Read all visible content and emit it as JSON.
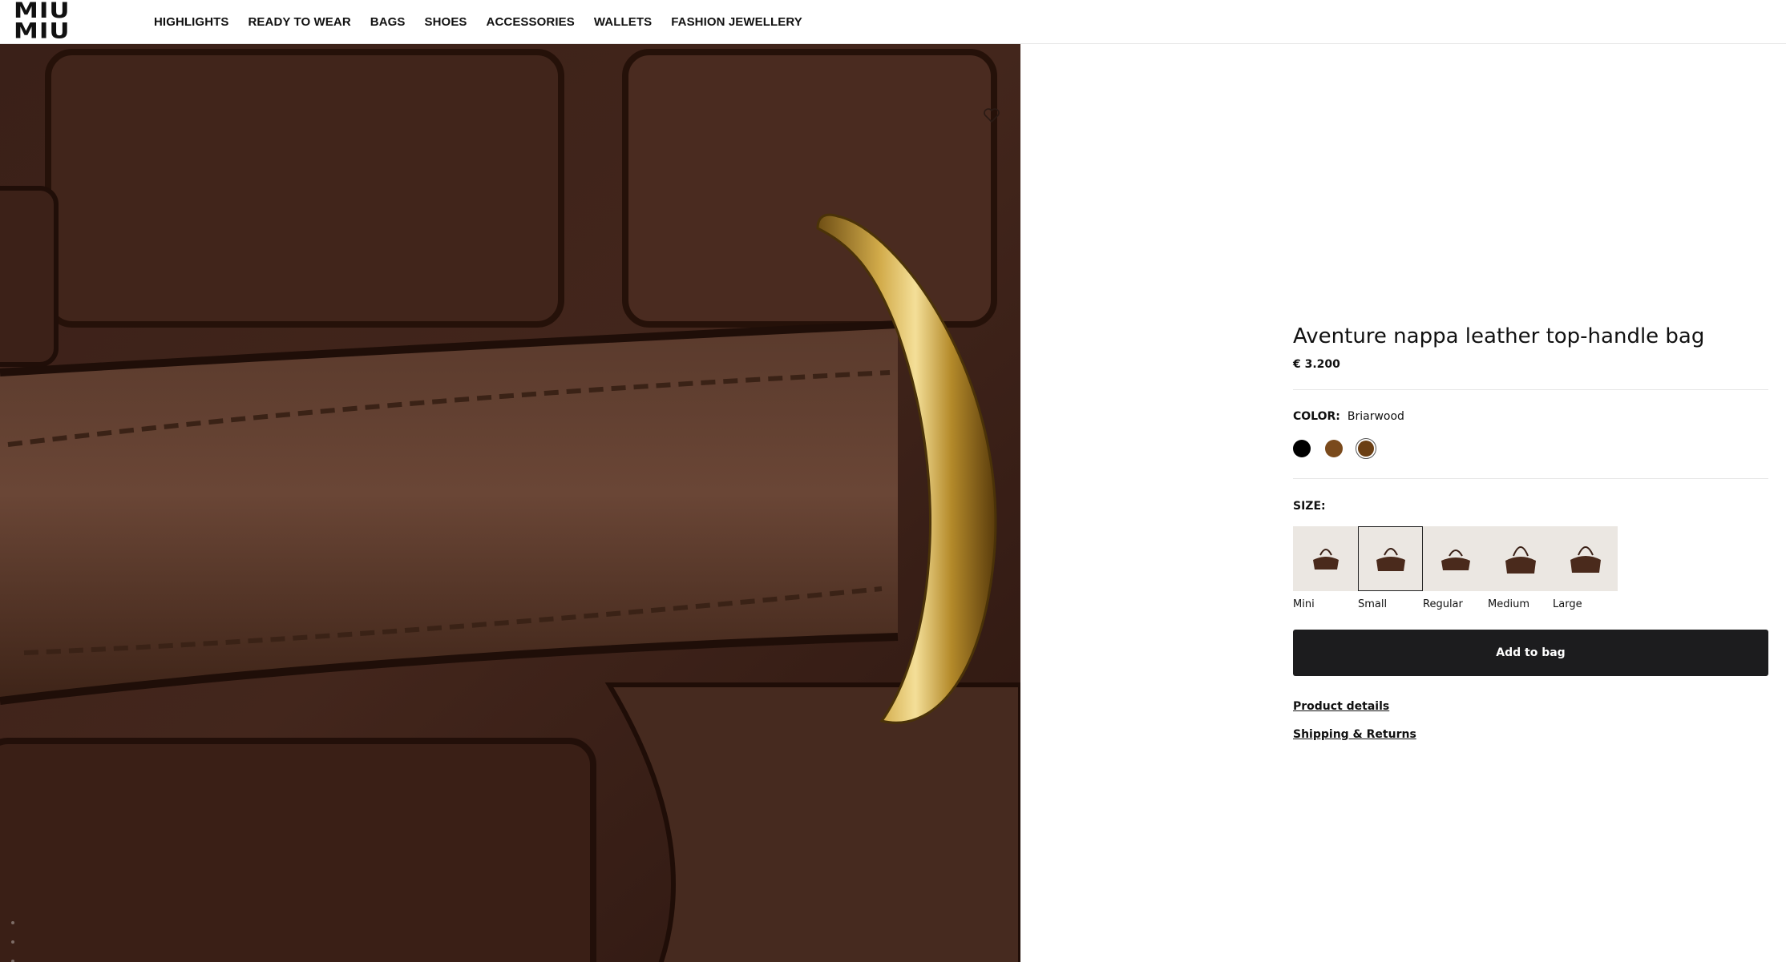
{
  "header": {
    "logo_text": "MIU MIU",
    "nav": [
      "HIGHLIGHTS",
      "READY TO WEAR",
      "BAGS",
      "SHOES",
      "ACCESSORIES",
      "WALLETS",
      "FASHION JEWELLERY"
    ]
  },
  "gallery": {
    "image_alt": "Close-up of brown leather strap with gold ring",
    "wishlist_icon": "heart-icon",
    "leather_color": "#3b2018",
    "hardware_color": "#b8902e"
  },
  "product": {
    "title": "Aventure nappa leather top-handle bag",
    "price": "€ 3.200",
    "color_label": "COLOR:",
    "color_value": "Briarwood",
    "swatches": [
      {
        "name": "Black",
        "hex": "#000000",
        "selected": false
      },
      {
        "name": "Brown",
        "hex": "#7a4a1c",
        "selected": false
      },
      {
        "name": "Briarwood",
        "hex": "#6b3f14",
        "selected": true
      }
    ],
    "size_label": "SIZE:",
    "sizes": [
      {
        "label": "Mini",
        "selected": false
      },
      {
        "label": "Small",
        "selected": true
      },
      {
        "label": "Regular",
        "selected": false
      },
      {
        "label": "Medium",
        "selected": false
      },
      {
        "label": "Large",
        "selected": false
      }
    ],
    "add_to_bag": "Add to bag",
    "links": [
      "Product details",
      "Shipping & Returns"
    ]
  }
}
